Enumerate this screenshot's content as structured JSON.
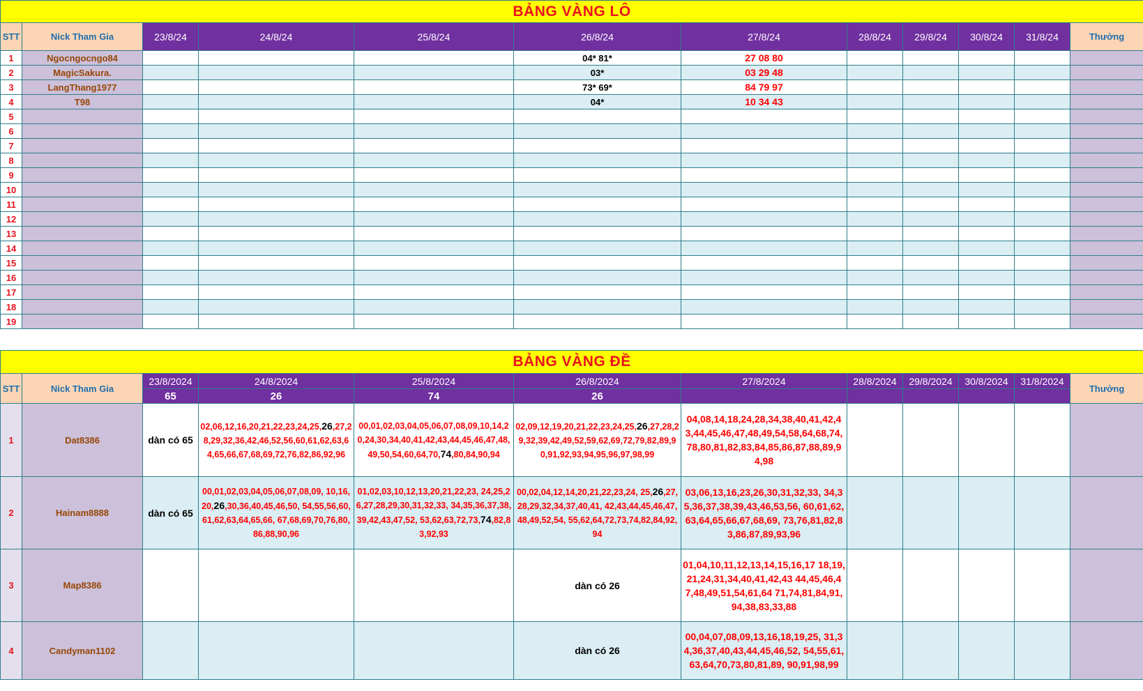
{
  "lo": {
    "title": "BẢNG VÀNG LÔ",
    "headers": {
      "stt": "STT",
      "nick": "Nick Tham Gia",
      "dates": [
        "23/8/24",
        "24/8/24",
        "25/8/24",
        "26/8/24",
        "27/8/24",
        "28/8/24",
        "29/8/24",
        "30/8/24",
        "31/8/24"
      ],
      "thuong": "Thưởng"
    },
    "rows": [
      {
        "stt": "1",
        "nick": "Ngocngocngo84",
        "d4": "04* 81*",
        "d5": "27 08 80"
      },
      {
        "stt": "2",
        "nick": "MagicSakura.",
        "d4": "03*",
        "d5": "03 29 48"
      },
      {
        "stt": "3",
        "nick": "LangThang1977",
        "d4": "73* 69*",
        "d5": "84 79 97"
      },
      {
        "stt": "4",
        "nick": "T98",
        "d4": "04*",
        "d5": "10 34 43"
      },
      {
        "stt": "5"
      },
      {
        "stt": "6"
      },
      {
        "stt": "7"
      },
      {
        "stt": "8"
      },
      {
        "stt": "9"
      },
      {
        "stt": "10"
      },
      {
        "stt": "11"
      },
      {
        "stt": "12"
      },
      {
        "stt": "13"
      },
      {
        "stt": "14"
      },
      {
        "stt": "15"
      },
      {
        "stt": "16"
      },
      {
        "stt": "17"
      },
      {
        "stt": "18"
      },
      {
        "stt": "19"
      }
    ]
  },
  "de": {
    "title": "BẢNG VÀNG ĐỀ",
    "headers": {
      "stt": "STT",
      "nick": "Nick Tham Gia",
      "dates": [
        "23/8/2024",
        "24/8/2024",
        "25/8/2024",
        "26/8/2024",
        "27/8/2024",
        "28/8/2024",
        "29/8/2024",
        "30/8/2024",
        "31/8/2024"
      ],
      "results": [
        "65",
        "26",
        "74",
        "26",
        "",
        "",
        "",
        "",
        ""
      ],
      "thuong": "Thưởng"
    },
    "rows": [
      {
        "stt": "1",
        "nick": "Dat8386",
        "c0": "dàn có 65",
        "c1a": "02,06,12,16,20,21,22,23,24,25,",
        "c1h": "26",
        "c1b": ",27,28,29,32,36,42,46,52,56,60,61,62,63,64,65,66,67,68,69,72,76,82,86,92,96",
        "c2a": "00,01,02,03,04,05,06,07,08,09,10,14,20,24,30,34,40,41,42,43,44,45,46,47,48,49,50,54,60,64,70,",
        "c2h": "74",
        "c2b": ",80,84,90,94",
        "c3a": "02,09,12,19,20,21,22,23,24,25,",
        "c3h": "26",
        "c3b": ",27,28,29,32,39,42,49,52,59,62,69,72,79,82,89,90,91,92,93,94,95,96,97,98,99",
        "c4": "04,08,14,18,24,28,34,38,40,41,42,43,44,45,46,47,48,49,54,58,64,68,74,78,80,81,82,83,84,85,86,87,88,89,94,98"
      },
      {
        "stt": "2",
        "nick": "Hainam8888",
        "c0": "dàn có 65",
        "c1a": "00,01,02,03,04,05,06,07,08,09, 10,16,20,",
        "c1h": "26",
        "c1b": ",30,36,40,45,46,50, 54,55,56,60,61,62,63,64,65,66, 67,68,69,70,76,80,86,88,90,96",
        "c2a": "01,02,03,10,12,13,20,21,22,23, 24,25,26,27,28,29,30,31,32,33, 34,35,36,37,38,39,42,43,47,52, 53,62,63,72,73,",
        "c2h": "74",
        "c2b": ",82,83,92,93",
        "c3a": "00,02,04,12,14,20,21,22,23,24, 25,",
        "c3h": "26",
        "c3b": ",27,28,29,32,34,37,40,41, 42,43,44,45,46,47,48,49,52,54, 55,62,64,72,73,74,82,84,92,94",
        "c4": "03,06,13,16,23,26,30,31,32,33, 34,35,36,37,38,39,43,46,53,56, 60,61,62,63,64,65,66,67,68,69, 73,76,81,82,83,86,87,89,93,96"
      },
      {
        "stt": "3",
        "nick": "Map8386",
        "c3": "dàn có 26",
        "c4": "01,04,10,11,12,13,14,15,16,17 18,19,21,24,31,34,40,41,42,43 44,45,46,47,48,49,51,54,61,64 71,74,81,84,91,94,38,83,33,88"
      },
      {
        "stt": "4",
        "nick": "Candyman1102",
        "c3": "dàn có 26",
        "c4": "00,04,07,08,09,13,16,18,19,25, 31,34,36,37,40,43,44,45,46,52, 54,55,61,63,64,70,73,80,81,89, 90,91,98,99"
      }
    ]
  }
}
